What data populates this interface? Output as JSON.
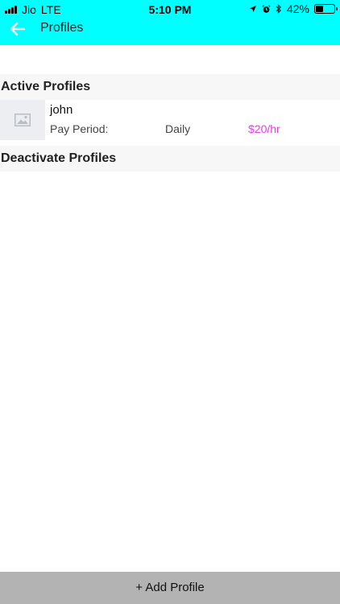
{
  "status_bar": {
    "carrier": "Jio",
    "network": "LTE",
    "time": "5:10 PM",
    "battery_percent": "42%",
    "battery_level": 0.42
  },
  "app_bar": {
    "title": "Profiles",
    "back_icon": "arrow-left-icon"
  },
  "sections": {
    "active_title": "Active Profiles",
    "deactivated_title": "Deactivate Profiles"
  },
  "active_profiles": [
    {
      "name": "john",
      "pay_period_label": "Pay Period:",
      "pay_period": "Daily",
      "rate": "$20/hr",
      "avatar_icon": "image-placeholder-icon"
    }
  ],
  "footer": {
    "add_label": "+ Add Profile"
  },
  "colors": {
    "topbar": "#00ffff",
    "rate": "#e040e0",
    "footer_bg": "#b3b3b3",
    "section_bg": "#f7f7f7"
  }
}
